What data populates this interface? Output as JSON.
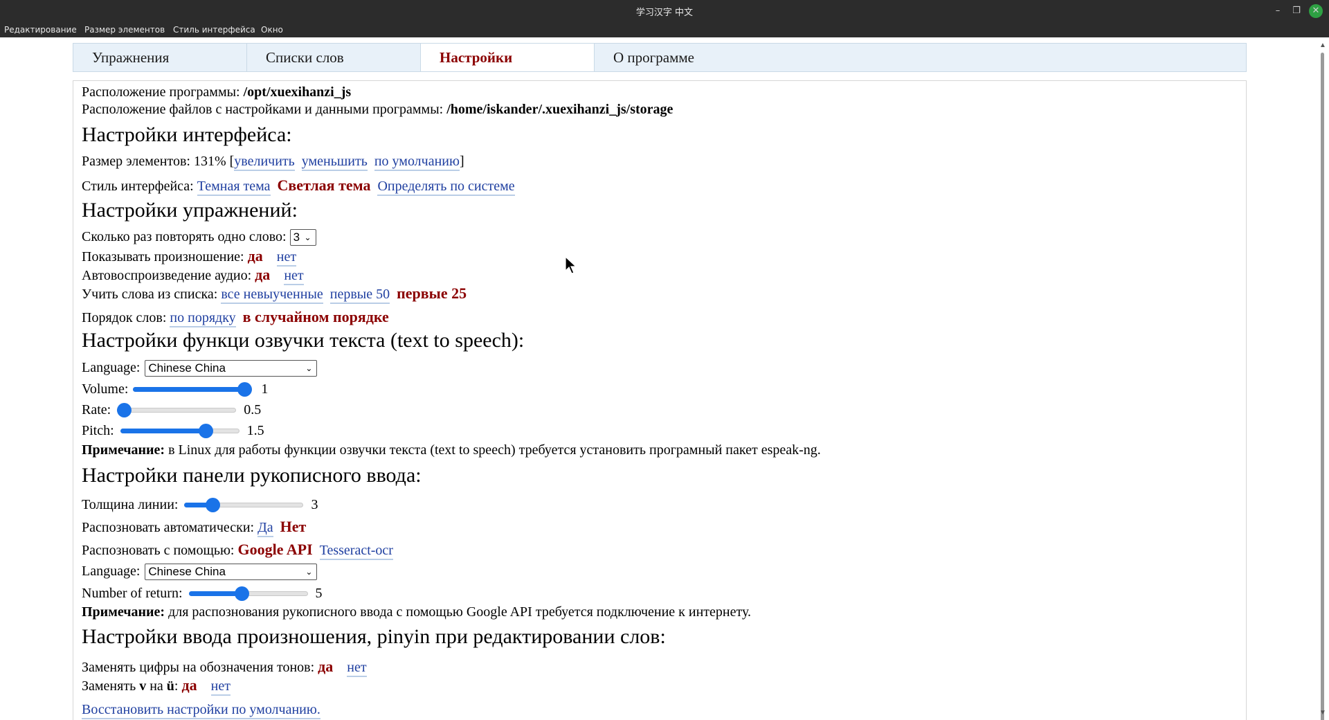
{
  "window": {
    "title": "学习汉字 中文",
    "min_icon": "–",
    "max_icon": "❐",
    "close_icon": "✕"
  },
  "menubar": [
    "Редактирование",
    "Размер элементов",
    "Стиль интерфейса",
    "Окно"
  ],
  "tabs": [
    "Упражнения",
    "Списки слов",
    "Настройки",
    "О программе"
  ],
  "active_tab": "Настройки",
  "paths": {
    "program_label": "Расположение программы: ",
    "program_path": "/opt/xuexihanzi_js",
    "storage_label": "Расположение файлов с настройками и данными программы: ",
    "storage_path": "/home/iskander/.xuexihanzi_js/storage"
  },
  "interface": {
    "heading": "Настройки интерфейса:",
    "size_label": "Размер элементов: 131% [",
    "increase": "увеличить",
    "decrease": "уменьшить",
    "default": "по умолчанию",
    "size_close": "]",
    "style_label": "Стиль интерфейса: ",
    "dark": "Темная тема",
    "light": "Светлая тема",
    "system": "Определять по системе"
  },
  "exercises": {
    "heading": "Настройки упражнений:",
    "repeat_label": "Сколько раз повторять одно слово: ",
    "repeat_value": "3",
    "pron_label": "Показывать произношение: ",
    "autoplay_label": "Автовоспроизведение аудио: ",
    "yes": "да",
    "no": "нет",
    "list_label": "Учить слова из списка: ",
    "all_unlearned": "все невыученные",
    "first50": "первые 50",
    "first25": "первые 25",
    "order_label": "Порядок слов: ",
    "in_order": "по порядку",
    "random": "в случайном порядке"
  },
  "tts": {
    "heading": "Настройки функци озвучки текста (text to speech):",
    "language_label": "Language:",
    "language_value": "Chinese China",
    "volume_label": "Volume:",
    "volume_value": "1",
    "volume_fraction": 1.0,
    "rate_label": "Rate:",
    "rate_value": "0.5",
    "rate_fraction": 0.0,
    "pitch_label": "Pitch:",
    "pitch_value": "1.5",
    "pitch_fraction": 0.75,
    "note_bold": "Примечание:",
    "note_text": " в Linux для работы функции озвучки текста (text to speech) требуется установить програмный пакет espeak-ng."
  },
  "handwriting": {
    "heading": "Настройки панели рукописного ввода:",
    "thickness_label": "Толщина линии:",
    "thickness_value": "3",
    "thickness_fraction": 0.2,
    "auto_label": "Распозновать автоматически: ",
    "auto_yes": "Да",
    "auto_no": "Нет",
    "engine_label": "Распозновать с помощью: ",
    "google": "Google API",
    "tesseract": "Tesseract-ocr",
    "language_label": "Language:",
    "language_value": "Chinese China",
    "return_label": "Number of return:",
    "return_value": "5",
    "return_fraction": 0.44,
    "note_bold": "Примечание:",
    "note_text": " для распознования рукописного ввода с помощью Google API требуется подключение к интернету."
  },
  "pinyin": {
    "heading": "Настройки ввода произношения, pinyin при редактировании слов:",
    "tones_label": "Заменять цифры на обозначения тонов: ",
    "v_label_1": "Заменять ",
    "v_bold": "v",
    "v_label_2": " на ",
    "u_bold": "ü",
    "v_label_3": ": ",
    "yes": "да",
    "no": "нет"
  },
  "restore": "Восстановить настройки по умолчанию.",
  "colors": {
    "accent": "#8b0000",
    "link": "#1f3fa0",
    "slider": "#1a73e8"
  }
}
